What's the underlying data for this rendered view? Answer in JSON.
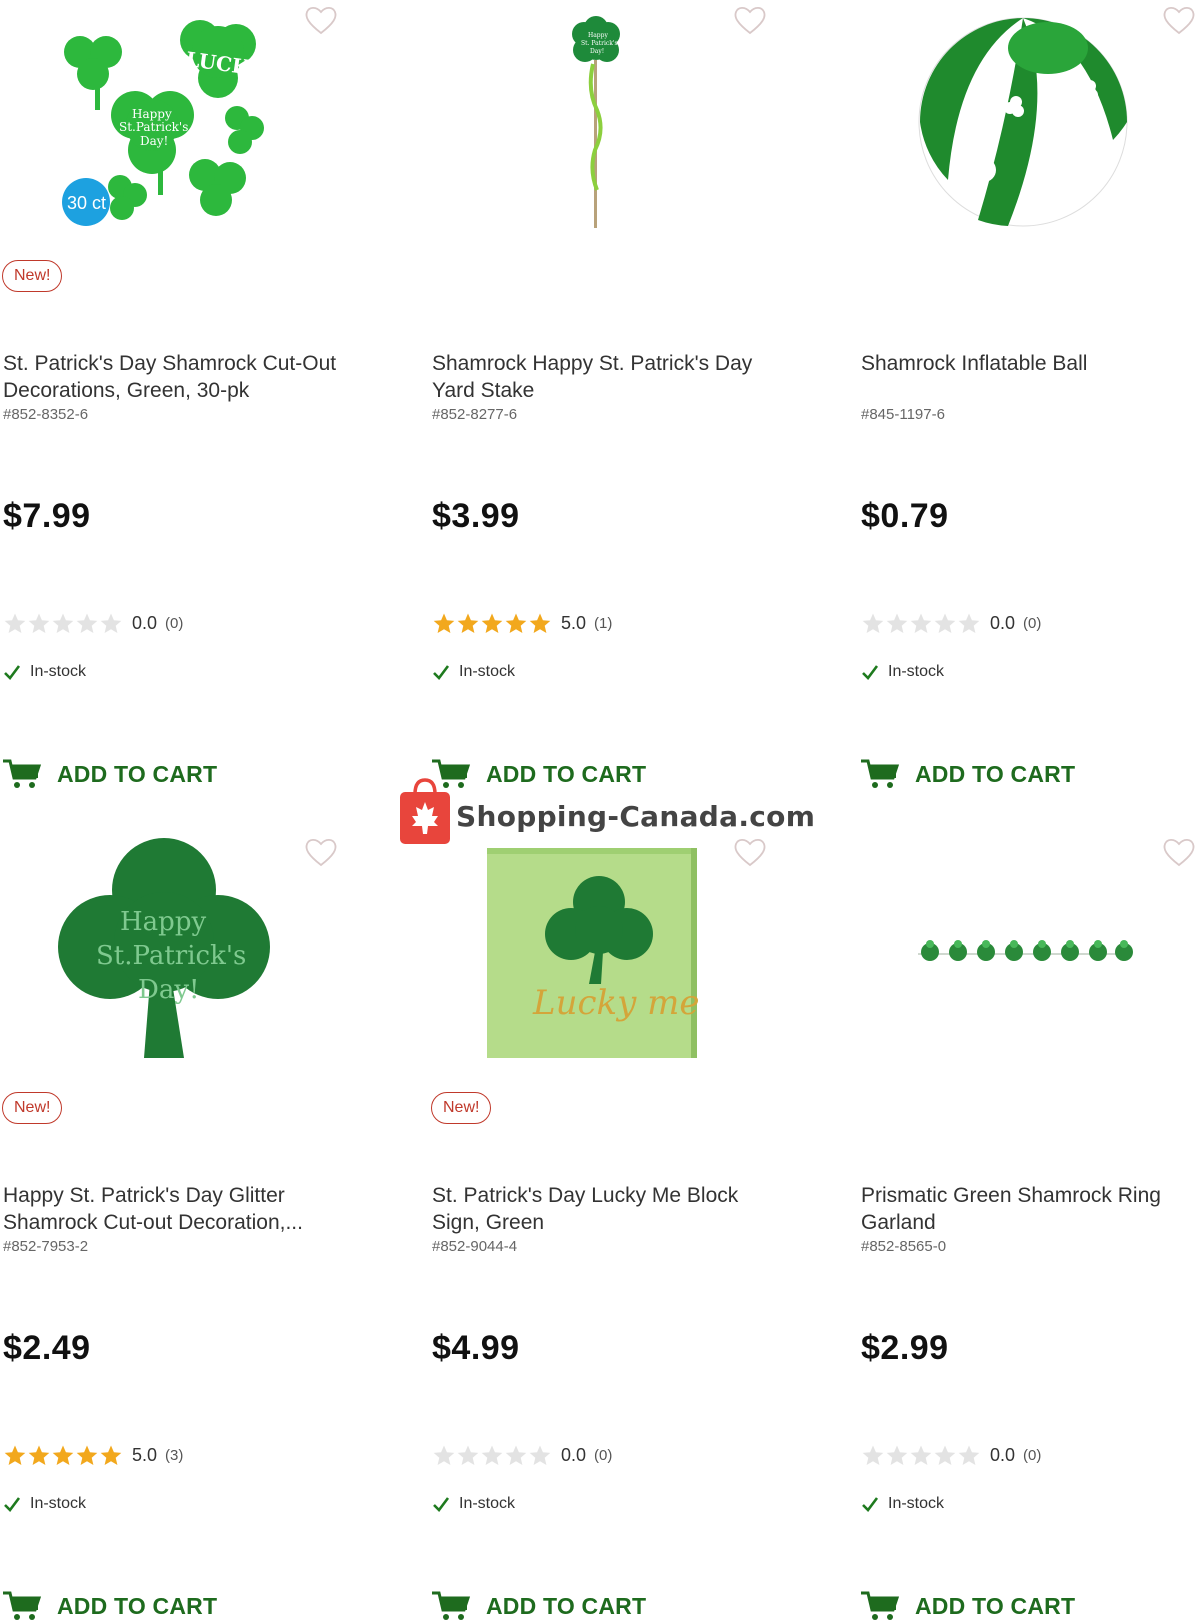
{
  "products": [
    {
      "badge": "New!",
      "title": "St. Patrick's Day Shamrock Cut-Out Decorations, Green, 30-pk",
      "sku": "#852-8352-6",
      "price": "$7.99",
      "rating": 0,
      "rating_text": "0.0",
      "review_count": "(0)",
      "stock": "In-stock",
      "cart_label": "ADD TO CART",
      "image_text": [
        "LUCKY",
        "Happy",
        "St.Patrick's",
        "Day!",
        "30 ct"
      ]
    },
    {
      "badge": "",
      "title": "Shamrock Happy St. Patrick's Day Yard Stake",
      "sku": "#852-8277-6",
      "price": "$3.99",
      "rating": 5,
      "rating_text": "5.0",
      "review_count": "(1)",
      "stock": "In-stock",
      "cart_label": "ADD TO CART",
      "image_text": [
        "Happy",
        "St. Patrick's",
        "Day!"
      ]
    },
    {
      "badge": "",
      "title": "Shamrock Inflatable Ball",
      "sku": "#845-1197-6",
      "price": "$0.79",
      "rating": 0,
      "rating_text": "0.0",
      "review_count": "(0)",
      "stock": "In-stock",
      "cart_label": "ADD TO CART",
      "image_text": []
    },
    {
      "badge": "New!",
      "title": "Happy St. Patrick's Day Glitter Shamrock Cut-out Decoration,...",
      "sku": "#852-7953-2",
      "price": "$2.49",
      "rating": 5,
      "rating_text": "5.0",
      "review_count": "(3)",
      "stock": "In-stock",
      "cart_label": "ADD TO CART",
      "image_text": [
        "Happy",
        "St.Patrick's",
        "Day!"
      ]
    },
    {
      "badge": "New!",
      "title": "St. Patrick's Day Lucky Me Block Sign, Green",
      "sku": "#852-9044-4",
      "price": "$4.99",
      "rating": 0,
      "rating_text": "0.0",
      "review_count": "(0)",
      "stock": "In-stock",
      "cart_label": "ADD TO CART",
      "image_text": [
        "Lucky me"
      ]
    },
    {
      "badge": "",
      "title": "Prismatic Green Shamrock Ring Garland",
      "sku": "#852-8565-0",
      "price": "$2.99",
      "rating": 0,
      "rating_text": "0.0",
      "review_count": "(0)",
      "stock": "In-stock",
      "cart_label": "ADD TO CART",
      "image_text": []
    }
  ],
  "watermark": {
    "text": "Shopping-Canada.com"
  },
  "colors": {
    "accent_green": "#1e6b1e",
    "badge_red": "#c0392b",
    "star_gold": "#f2a81d",
    "star_empty": "#e3e3e3",
    "check_green": "#1e7a1e",
    "watermark_red": "#e8453c"
  },
  "icons": {
    "wishlist": "heart-outline-icon",
    "cart": "shopping-cart-icon",
    "stock": "checkmark-icon",
    "rating": "star-icon",
    "watermark": "shopping-bag-maple-leaf-icon"
  }
}
